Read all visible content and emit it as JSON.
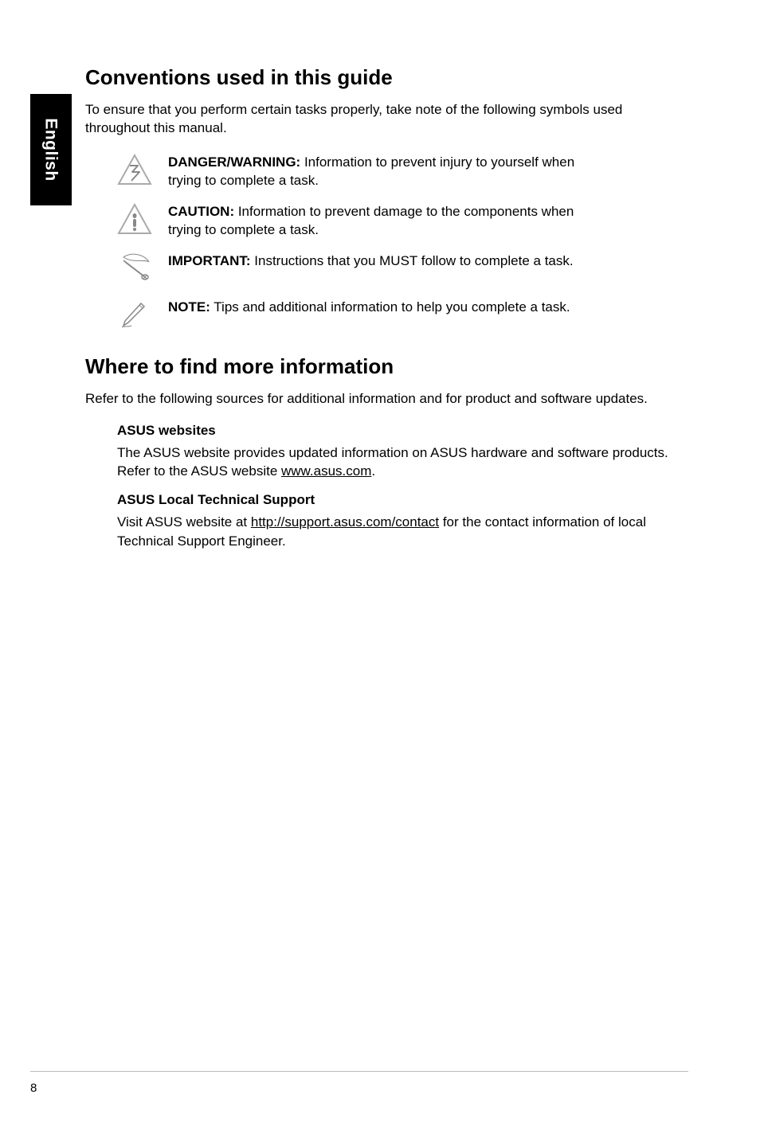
{
  "sidebar": {
    "language": "English"
  },
  "section1": {
    "heading": "Conventions used in this guide",
    "intro": "To ensure that you perform certain tasks properly, take note of the following symbols used throughout this manual.",
    "callouts": [
      {
        "label": "DANGER/WARNING:",
        "body": " Information to prevent injury to yourself when trying to complete a task."
      },
      {
        "label": "CAUTION:",
        "body": " Information to prevent damage to the components when trying to complete a task."
      },
      {
        "label": "IMPORTANT:",
        "body": " Instructions that you MUST follow to complete a task."
      },
      {
        "label": "NOTE:",
        "body": " Tips and additional information to help you complete a task."
      }
    ]
  },
  "section2": {
    "heading": "Where to find more information",
    "intro": "Refer to the following sources for additional information and for product and software updates.",
    "items": [
      {
        "head": "ASUS websites",
        "pre": "The ASUS website provides updated information on ASUS hardware and software products. Refer to the ASUS website ",
        "link": "www.asus.com",
        "post": "."
      },
      {
        "head": "ASUS Local Technical Support",
        "pre": "Visit ASUS website at ",
        "link": "http://support.asus.com/contact",
        "post": " for the contact information of local Technical Support Engineer."
      }
    ]
  },
  "page": {
    "number": "8"
  }
}
